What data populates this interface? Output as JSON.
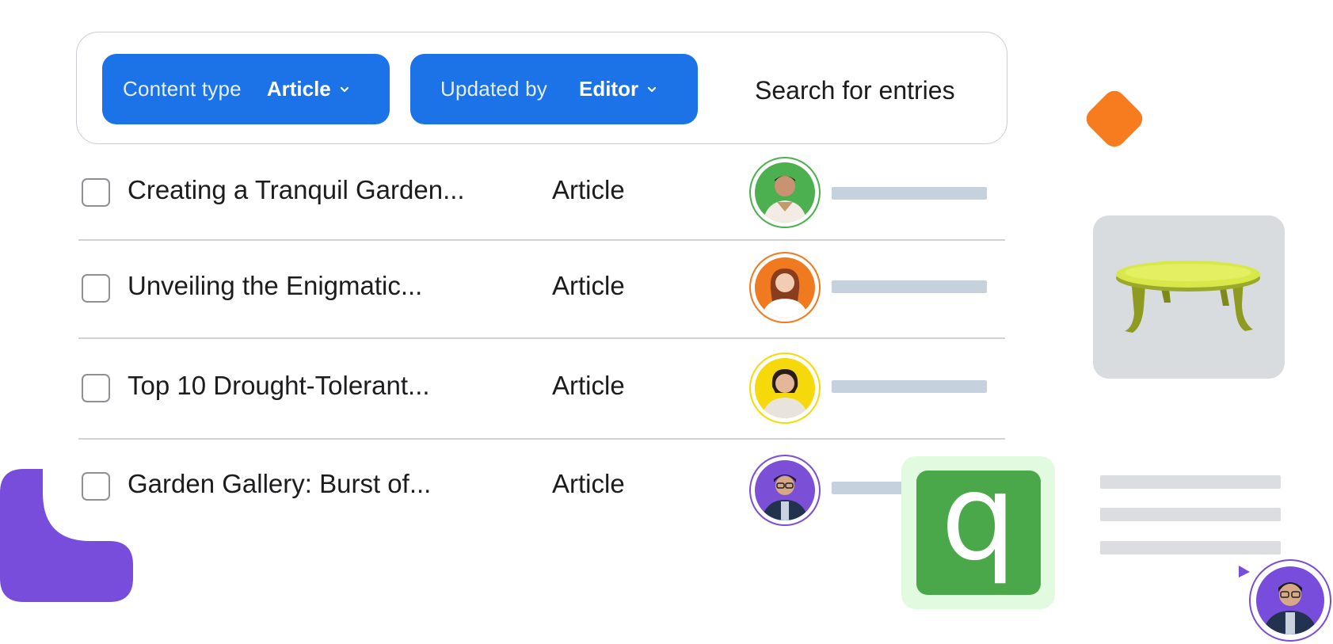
{
  "filters": {
    "content_type": {
      "label": "Content type",
      "value": "Article"
    },
    "updated_by": {
      "label": "Updated by",
      "value": "Editor"
    },
    "search_label": "Search for entries"
  },
  "entries": [
    {
      "title": "Creating a Tranquil Garden...",
      "type": "Article",
      "avatar_color": "#4caf50",
      "ring_color": "#4caf50"
    },
    {
      "title": "Unveiling the Enigmatic...",
      "type": "Article",
      "avatar_color": "#f07a20",
      "ring_color": "#f07a20"
    },
    {
      "title": "Top 10 Drought-Tolerant...",
      "type": "Article",
      "avatar_color": "#f5d90a",
      "ring_color": "#f5d90a"
    },
    {
      "title": "Garden Gallery: Burst of...",
      "type": "Article",
      "avatar_color": "#7b4fd6",
      "ring_color": "#7b4fd6"
    }
  ],
  "app_tile": {
    "letter": "q",
    "color": "#4ba84a",
    "bg": "#e2fbe0"
  },
  "colors": {
    "accent_blue": "#1c73e8",
    "orange": "#f77b1f",
    "purple": "#784ddb",
    "placeholder_bar": "#c5d2de"
  },
  "icons": [
    "chevron-down-icon",
    "table-image",
    "cursor-pointer-icon"
  ]
}
